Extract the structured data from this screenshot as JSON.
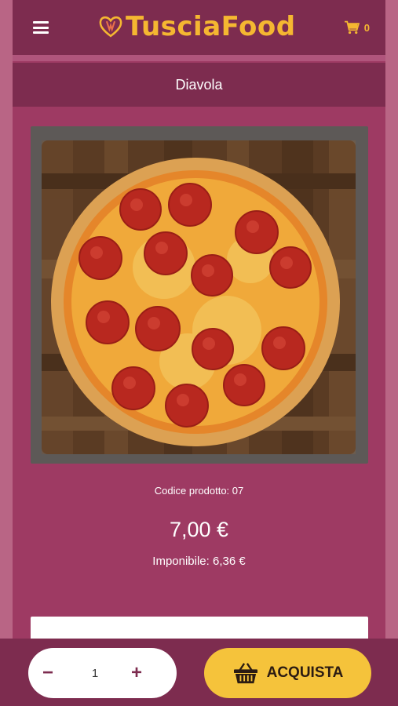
{
  "header": {
    "brand": "TusciaFood",
    "cart_count": "0"
  },
  "product": {
    "name": "Diavola",
    "code": "Codice prodotto: 07",
    "price": "7,00 €",
    "imponibile": "Imponibile: 6,36 €"
  },
  "quantity": {
    "minus": "−",
    "value": "1",
    "plus": "+"
  },
  "buy_button": {
    "label": "ACQUISTA"
  },
  "colors": {
    "primary": "#7d2c4f",
    "background": "#9e3a63",
    "accent": "#f5b731"
  },
  "icons": {
    "menu": "hamburger-menu-icon",
    "cart": "shopping-cart-icon",
    "basket": "basket-icon",
    "logo_heart": "heart-icon"
  }
}
